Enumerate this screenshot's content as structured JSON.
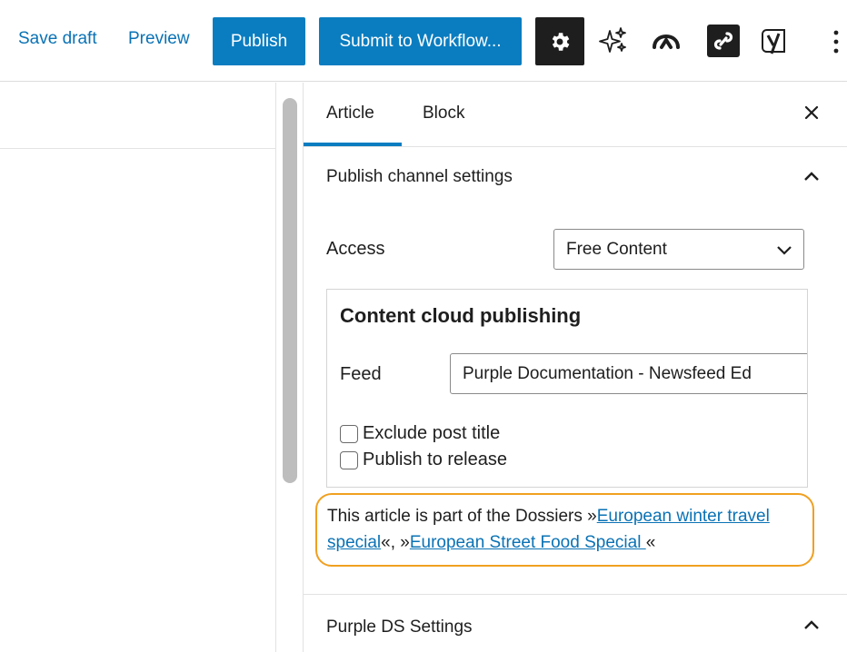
{
  "toolbar": {
    "save_draft": "Save draft",
    "preview": "Preview",
    "publish": "Publish",
    "submit_workflow": "Submit to Workflow...",
    "icons": [
      "settings-gear-icon",
      "ai-sparkles-icon",
      "wave-logo-icon",
      "link-chain-icon",
      "yoast-icon",
      "more-options-icon"
    ]
  },
  "sidebar": {
    "tabs": [
      {
        "label": "Article",
        "active": true
      },
      {
        "label": "Block",
        "active": false
      }
    ],
    "publish_channel": {
      "title": "Publish channel settings",
      "access_label": "Access",
      "access_value": "Free Content"
    },
    "content_cloud": {
      "title": "Content cloud publishing",
      "feed_label": "Feed",
      "feed_value": "Purple Documentation - Newsfeed Ed",
      "checkboxes": [
        {
          "label": "Exclude post title",
          "checked": false
        },
        {
          "label": "Publish to release",
          "checked": false
        }
      ]
    },
    "dossier": {
      "prefix": "This article is part of the Dossiers »",
      "link1": "European winter travel special",
      "middle": "«, »",
      "link2": "European Street Food Special ",
      "suffix": "«"
    },
    "purple_ds": {
      "title": "Purple DS Settings"
    }
  },
  "colors": {
    "accent": "#0a7dc0",
    "link": "#0a72b5",
    "highlight_border": "#f0a020"
  }
}
